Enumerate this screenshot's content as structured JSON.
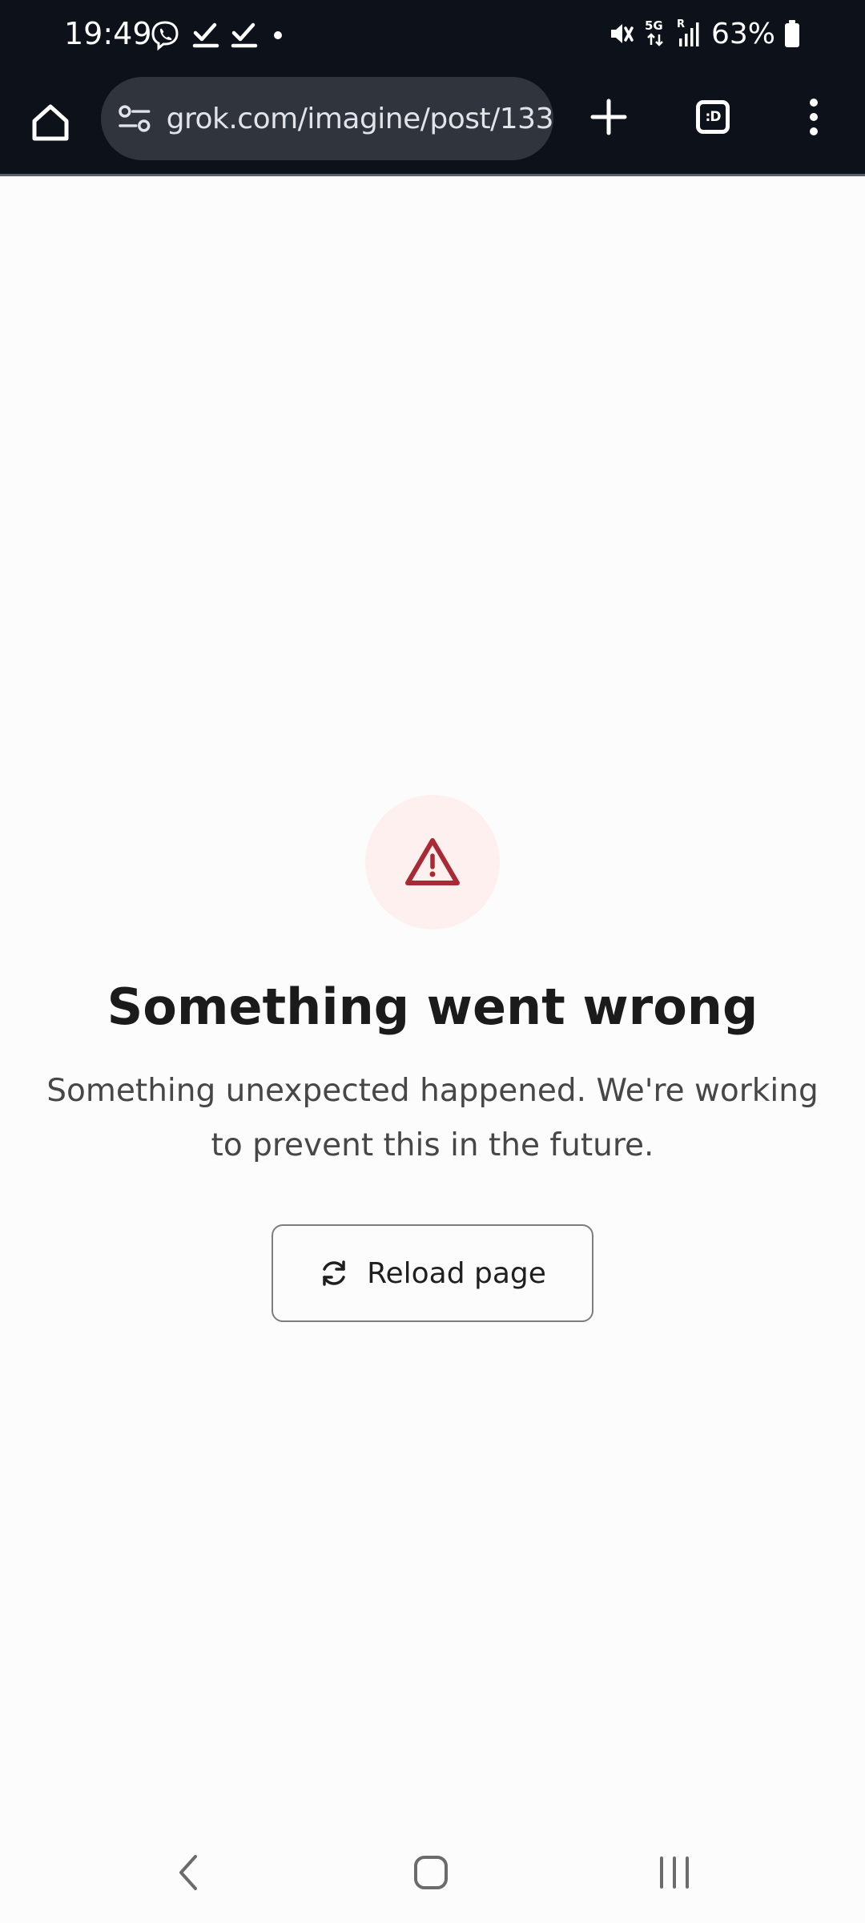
{
  "status_bar": {
    "time": "19:49",
    "battery_percent": "63%",
    "network_label": "5G",
    "roaming_label": "R",
    "left_icons": [
      "viber-icon",
      "check-icon",
      "check-icon",
      "dot-icon"
    ],
    "right_icons": [
      "mute-icon",
      "network-5g-icon",
      "signal-icon",
      "battery-icon"
    ]
  },
  "browser": {
    "url": "grok.com/imagine/post/133",
    "tab_count_label": ":D",
    "icons": {
      "home": "home-icon",
      "site_info": "tune-icon",
      "new_tab": "plus-icon",
      "tabs": "tab-switcher-icon",
      "menu": "more-vert-icon"
    }
  },
  "error": {
    "icon": "warning-triangle-icon",
    "title": "Something went wrong",
    "description": "Something unexpected happened. We're working to prevent this in the future.",
    "reload_label": "Reload page",
    "reload_icon": "refresh-icon"
  },
  "colors": {
    "toolbar_bg": "#0c111a",
    "url_bg": "#30343c",
    "page_bg": "#fcfcfc",
    "warn_circle_bg": "#fdf0ef",
    "warn_red": "#a82a35",
    "title_text": "#1b1b1b",
    "desc_text": "#474747"
  },
  "nav": {
    "icons": [
      "back-icon",
      "home-icon",
      "recents-icon"
    ]
  }
}
